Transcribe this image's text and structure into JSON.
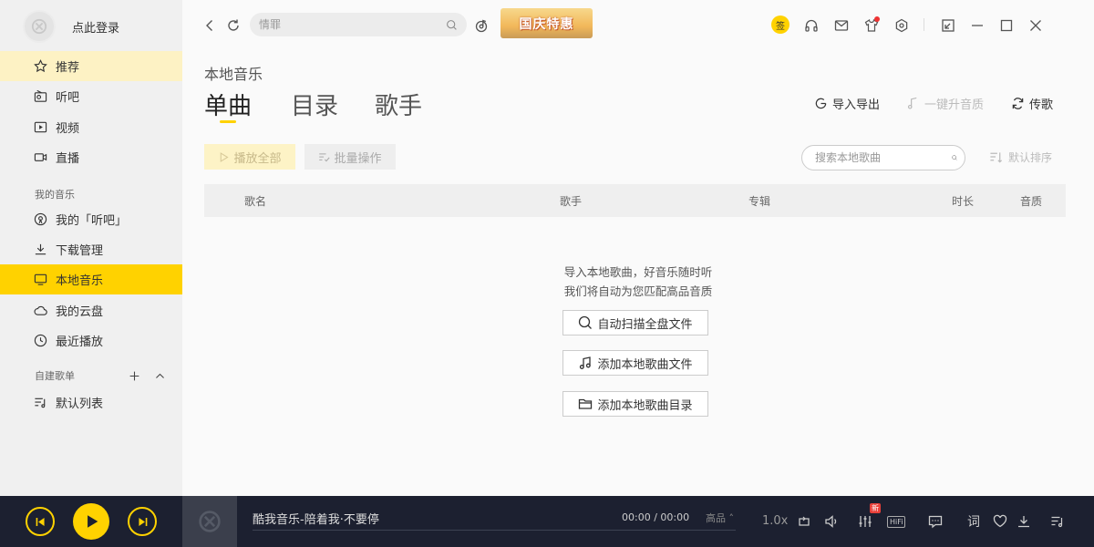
{
  "sidebar": {
    "login_label": "点此登录",
    "items": [
      {
        "label": "推荐",
        "icon": "star-icon"
      },
      {
        "label": "听吧",
        "icon": "radio-icon"
      },
      {
        "label": "视频",
        "icon": "video-icon"
      },
      {
        "label": "直播",
        "icon": "live-camera-icon"
      }
    ],
    "my_music_label": "我的音乐",
    "my_items": [
      {
        "label": "我的「听吧」",
        "icon": "podcast-icon"
      },
      {
        "label": "下载管理",
        "icon": "download-icon"
      },
      {
        "label": "本地音乐",
        "icon": "monitor-icon"
      },
      {
        "label": "我的云盘",
        "icon": "cloud-icon"
      },
      {
        "label": "最近播放",
        "icon": "clock-icon"
      }
    ],
    "playlist_label": "自建歌单",
    "playlists": [
      {
        "label": "默认列表",
        "icon": "playlist-icon"
      }
    ]
  },
  "topbar": {
    "search_placeholder": "情罪",
    "promo_label": "国庆特惠",
    "vip_label": "签"
  },
  "main": {
    "breadcrumb": "本地音乐",
    "tabs": [
      {
        "label": "单曲",
        "active": true
      },
      {
        "label": "目录",
        "active": false
      },
      {
        "label": "歌手",
        "active": false
      }
    ],
    "actions": {
      "import_export": "导入导出",
      "upgrade_quality": "一键升音质",
      "transfer": "传歌"
    },
    "play_all_label": "播放全部",
    "batch_label": "批量操作",
    "local_search_placeholder": "搜索本地歌曲",
    "sort_label": "默认排序",
    "columns": [
      "歌名",
      "歌手",
      "专辑",
      "时长",
      "音质"
    ],
    "empty": {
      "line1": "导入本地歌曲，好音乐随时听",
      "line2": "我们将自动为您匹配高品音质",
      "scan_label": "自动扫描全盘文件",
      "add_file_label": "添加本地歌曲文件",
      "add_dir_label": "添加本地歌曲目录"
    }
  },
  "player": {
    "song_title": "酷我音乐-陪着我·不要停",
    "time": "00:00 / 00:00",
    "quality": "高品 ˄",
    "speed": "1.0x",
    "new_badge": "新",
    "hifi_label": "HiFi",
    "lyrics_label": "词"
  },
  "colors": {
    "accent": "#ffd200",
    "player_bg": "#1c2030",
    "sidebar_bg": "#f0f0f0"
  }
}
